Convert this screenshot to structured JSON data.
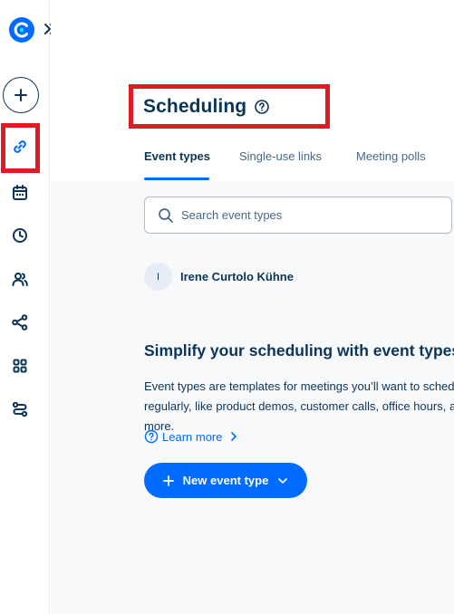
{
  "colors": {
    "brand": "#006bff",
    "text": "#0b3558",
    "muted": "#476788",
    "highlight": "#e01b24"
  },
  "sidebar": {
    "logo_icon": "calendly-logo-icon",
    "expand_icon": "double-chevron-right-icon",
    "create_icon": "plus-icon",
    "items": [
      {
        "name": "scheduling",
        "icon": "link-icon",
        "active": true
      },
      {
        "name": "meetings",
        "icon": "calendar-icon"
      },
      {
        "name": "availability",
        "icon": "clock-icon"
      },
      {
        "name": "contacts",
        "icon": "people-icon"
      },
      {
        "name": "workflows",
        "icon": "workflow-icon"
      },
      {
        "name": "integrations",
        "icon": "apps-grid-icon"
      },
      {
        "name": "routing",
        "icon": "routing-icon"
      }
    ]
  },
  "header": {
    "title": "Scheduling",
    "help_icon": "question-circle-icon"
  },
  "tabs": [
    {
      "label": "Event types",
      "active": true
    },
    {
      "label": "Single-use links",
      "active": false
    },
    {
      "label": "Meeting polls",
      "active": false
    }
  ],
  "search": {
    "placeholder": "Search event types",
    "value": ""
  },
  "user": {
    "initial": "I",
    "name": "Irene Curtolo Kühne"
  },
  "empty_state": {
    "heading": "Simplify your scheduling with event types",
    "body": "Event types are templates for meetings you’ll want to schedule regularly, like product demos, customer calls, office hours, and more.",
    "learn_more": "Learn more"
  },
  "new_button": {
    "label": "New event type"
  }
}
